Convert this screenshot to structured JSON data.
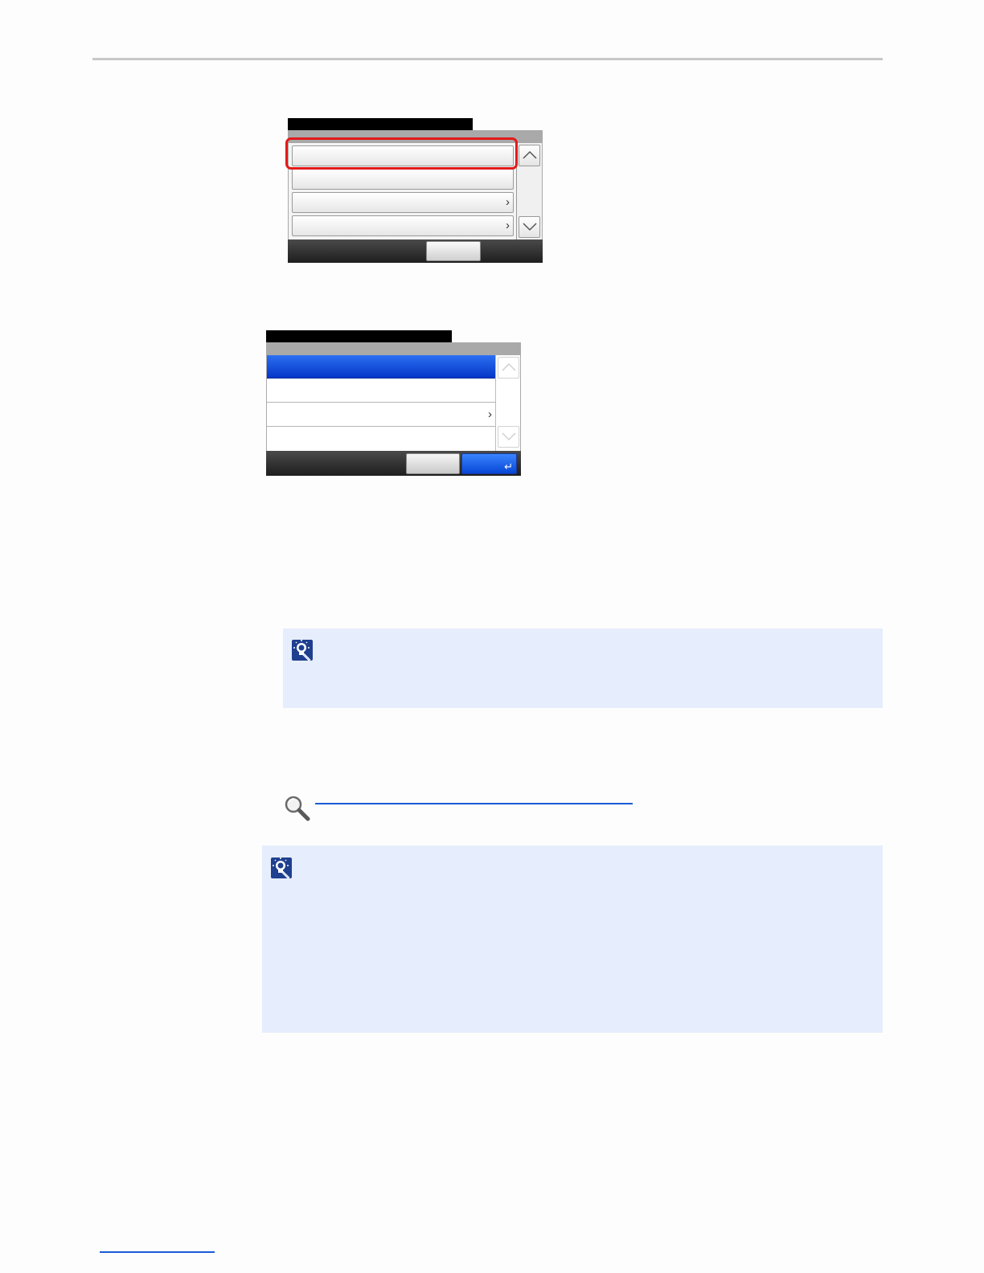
{
  "document": {
    "colors": {
      "rule": "#c8c8c8",
      "note_background": "#e6edfc",
      "highlight_frame": "#e31a1a",
      "selected_row": "#0a4be0",
      "link": "#1a5bd6"
    },
    "icons": {
      "scroll_up": "chevron-up-icon",
      "scroll_down": "chevron-down-icon",
      "row_arrow": "chevron-right-icon",
      "enter": "enter-icon",
      "note": "tip-lightbulb-icon",
      "reference": "magnifier-icon"
    },
    "panel1": {
      "chevron_glyph": "›"
    },
    "panel2": {
      "chevron_glyph": "›",
      "enter_glyph": "↵"
    }
  }
}
